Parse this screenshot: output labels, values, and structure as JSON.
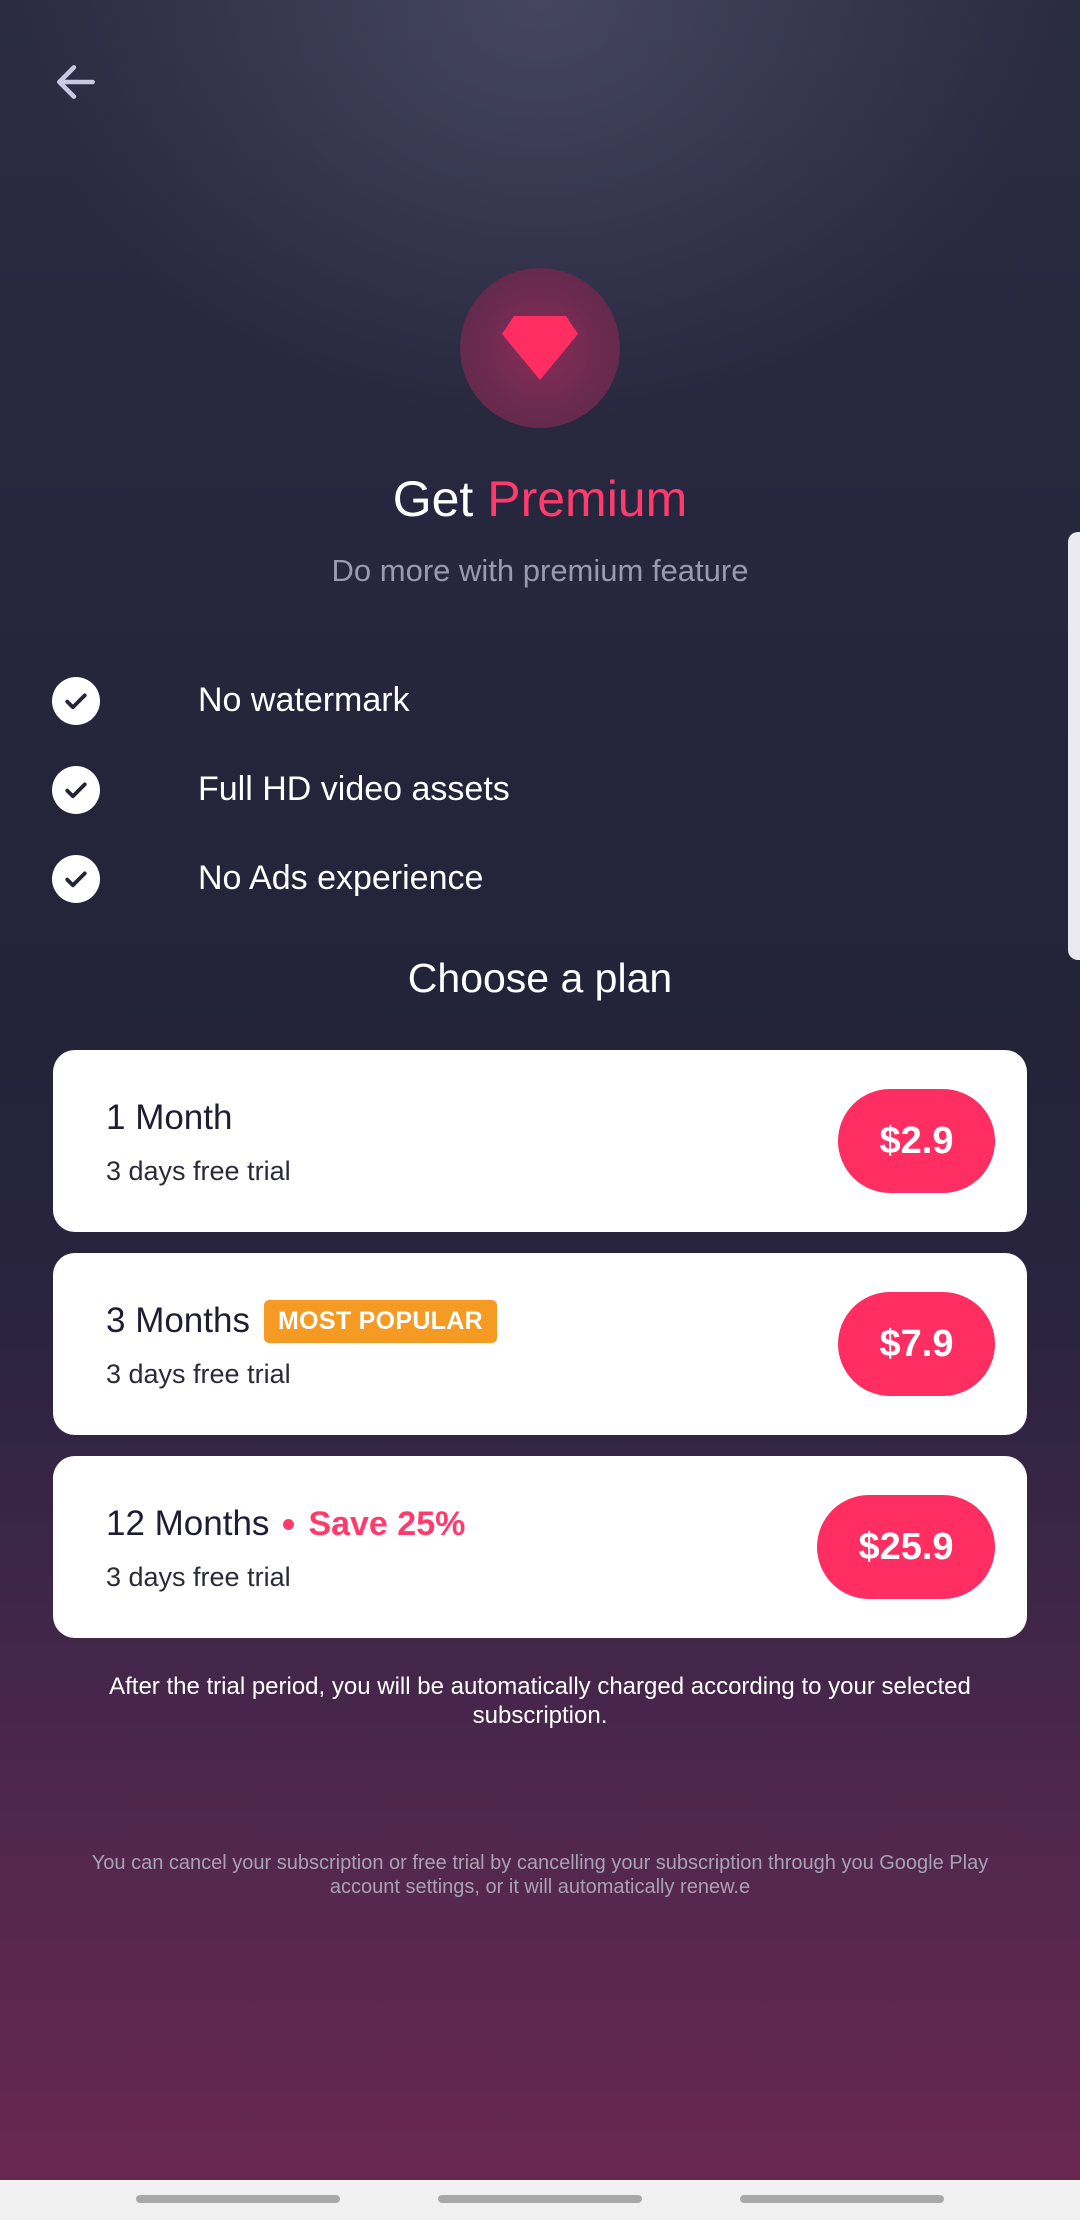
{
  "header": {
    "back_icon": "arrow-left-icon"
  },
  "hero": {
    "icon": "diamond-icon",
    "title_prefix": "Get",
    "title_accent": "Premium",
    "subtitle": "Do more with premium feature"
  },
  "features": [
    {
      "label": "No watermark"
    },
    {
      "label": "Full HD video assets"
    },
    {
      "label": "No Ads experience"
    }
  ],
  "plans_heading": "Choose a plan",
  "plans": [
    {
      "name": "1 Month",
      "trial": "3 days free trial",
      "price": "$2.9"
    },
    {
      "name": "3 Months",
      "badge": "MOST POPULAR",
      "trial": "3 days free trial",
      "price": "$7.9"
    },
    {
      "name": "12 Months",
      "save": "Save 25%",
      "trial": "3 days free trial",
      "price": "$25.9"
    }
  ],
  "trial_note": "After the trial period, you will be automatically charged according to your selected subscription.",
  "fine_print": "You can cancel your subscription or free trial by cancelling your subscription through you Google Play account settings, or it will automatically renew.e",
  "colors": {
    "accent": "#ff2e62",
    "badge": "#f59a23",
    "card": "#ffffff"
  }
}
